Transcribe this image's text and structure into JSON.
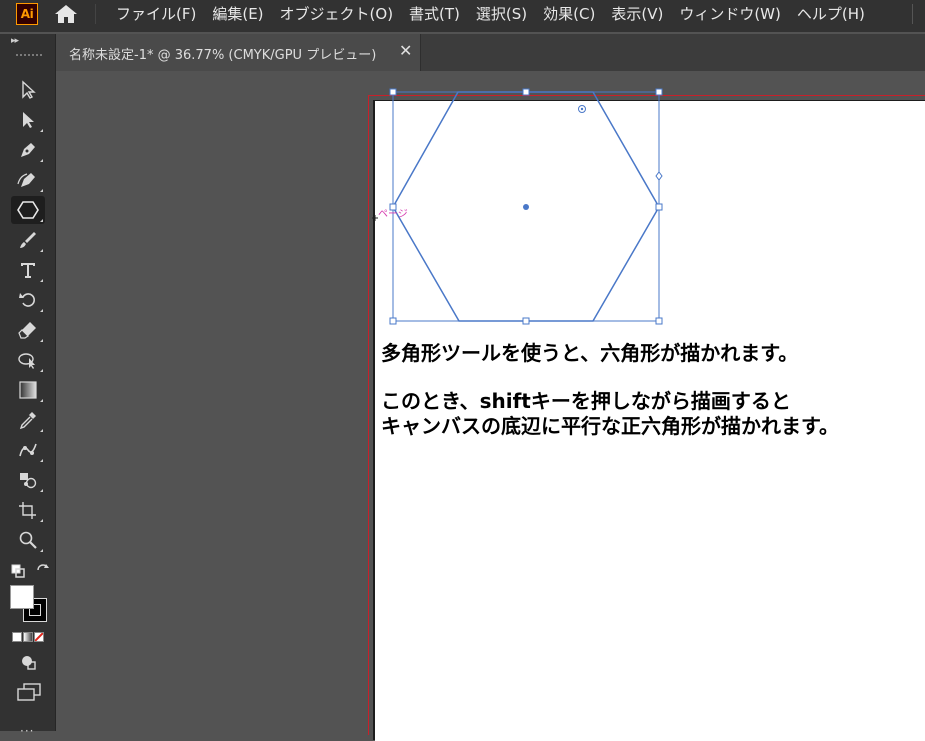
{
  "app": {
    "logo_text": "Ai",
    "menu": [
      "ファイル(F)",
      "編集(E)",
      "オブジェクト(O)",
      "書式(T)",
      "選択(S)",
      "効果(C)",
      "表示(V)",
      "ウィンドウ(W)",
      "ヘルプ(H)"
    ]
  },
  "document_tab": {
    "title": "名称未設定-1* @ 36.77% (CMYK/GPU プレビュー)",
    "close_glyph": "✕"
  },
  "toolbar": {
    "collapse_glyph": "▸▸",
    "tools": [
      "selection-tool",
      "direct-selection-tool",
      "pen-tool",
      "curvature-tool",
      "polygon-tool",
      "paintbrush-tool",
      "type-tool",
      "rotate-tool",
      "eraser-tool",
      "shape-builder-tool",
      "gradient-tool",
      "eyedropper-tool",
      "puppet-warp-tool",
      "symbol-sprayer-tool",
      "artboard-tool",
      "zoom-tool"
    ],
    "active_tool": "polygon-tool",
    "fill_color": "#ffffff",
    "stroke_color": "#000000"
  },
  "canvas": {
    "page_label": "ページ",
    "caption_lines": [
      "多角形ツールを使うと、六角形が描かれます。",
      "このとき、shiftキーを押しながら描画すると",
      "キャンバスの底辺に平行な正六角形が描かれます。"
    ],
    "selection_color": "#4a78c8",
    "bleed_color": "#c8202a"
  }
}
